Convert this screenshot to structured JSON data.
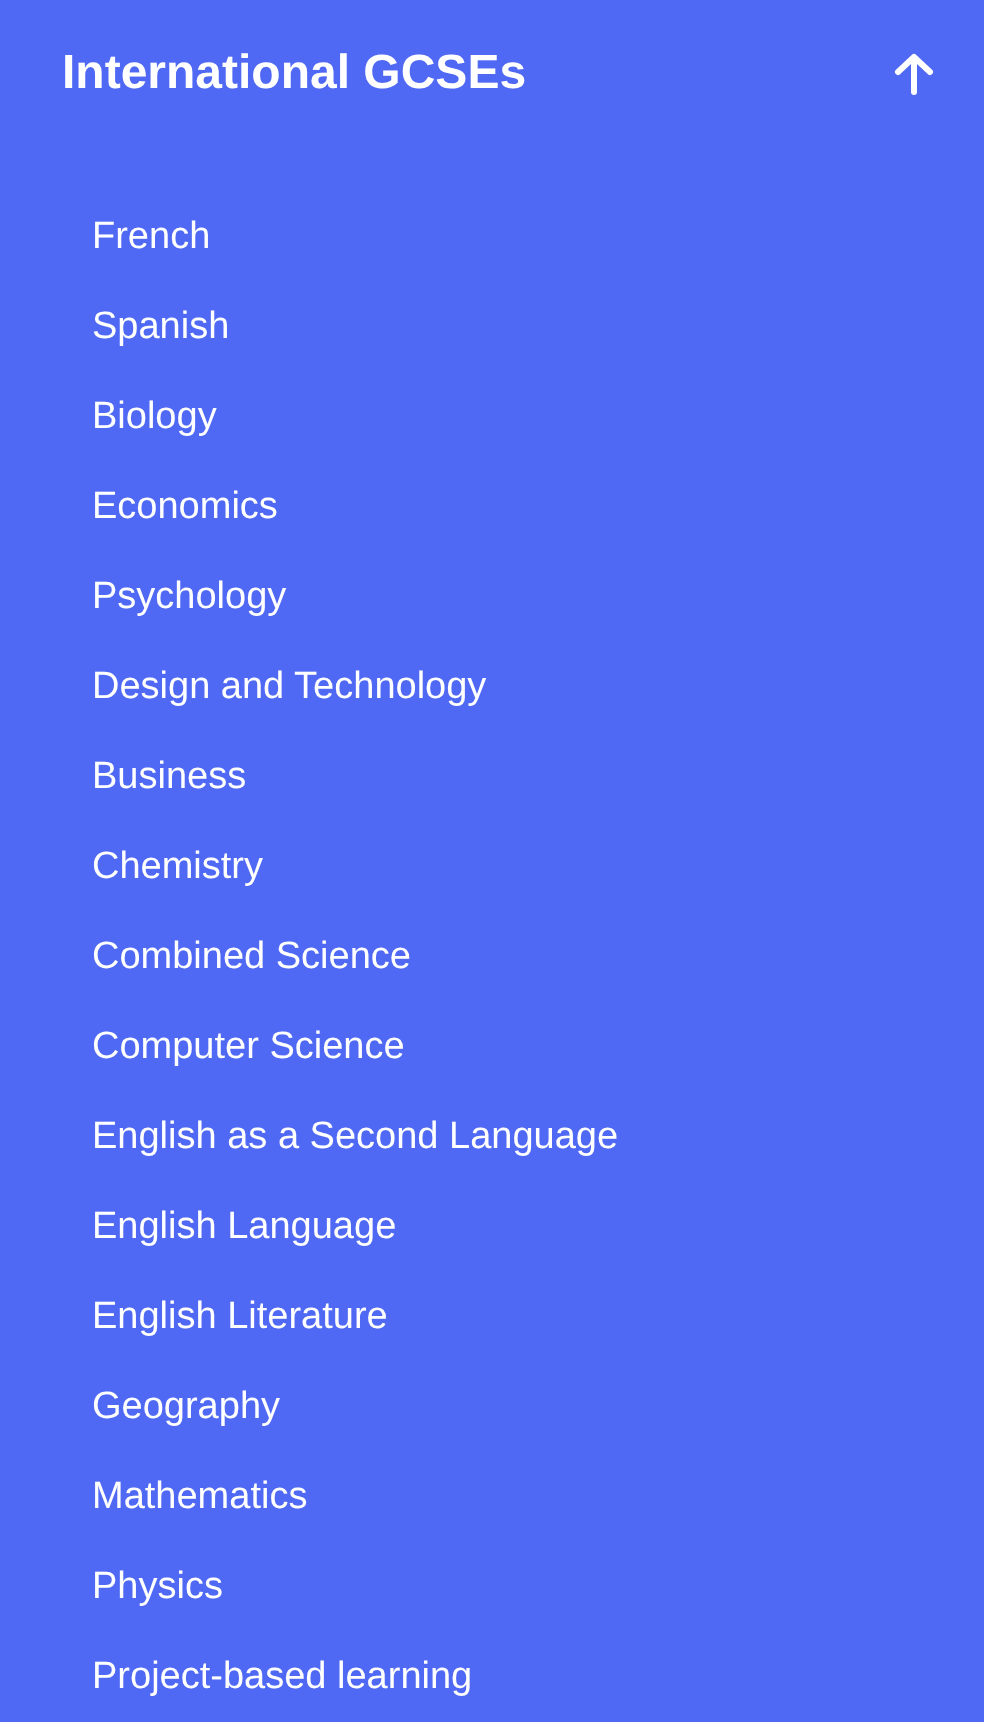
{
  "header": {
    "title": "International GCSEs",
    "expanded": true
  },
  "items": [
    {
      "label": "French"
    },
    {
      "label": "Spanish"
    },
    {
      "label": "Biology"
    },
    {
      "label": "Economics"
    },
    {
      "label": "Psychology"
    },
    {
      "label": "Design and Technology"
    },
    {
      "label": "Business"
    },
    {
      "label": "Chemistry"
    },
    {
      "label": "Combined Science"
    },
    {
      "label": "Computer Science"
    },
    {
      "label": "English as a Second Language"
    },
    {
      "label": "English Language"
    },
    {
      "label": "English Literature"
    },
    {
      "label": "Geography"
    },
    {
      "label": "Mathematics"
    },
    {
      "label": "Physics"
    },
    {
      "label": "Project-based learning"
    }
  ]
}
